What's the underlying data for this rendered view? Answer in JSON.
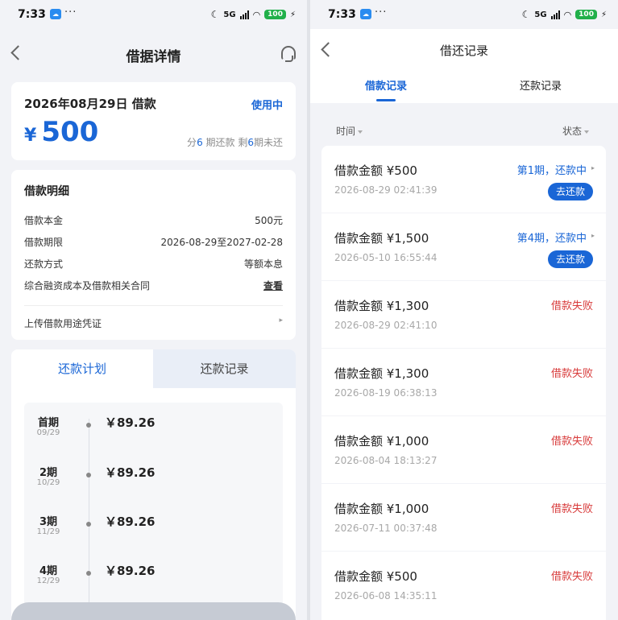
{
  "status_bar": {
    "time": "7:33",
    "network": "5G",
    "battery": "100"
  },
  "left": {
    "nav_title": "借据详情",
    "summary": {
      "date_label": "2026年08月29日 借款",
      "status": "使用中",
      "currency": "¥",
      "amount": "500",
      "terms_prefix": "分",
      "terms_total": "6",
      "terms_mid": " 期还款 剩",
      "terms_left": "6",
      "terms_suffix": "期未还"
    },
    "detail": {
      "title": "借款明细",
      "rows": [
        {
          "key": "借款本金",
          "value": "500元"
        },
        {
          "key": "借款期限",
          "value": "2026-08-29至2027-02-28"
        },
        {
          "key": "还款方式",
          "value": "等额本息"
        },
        {
          "key": "综合融资成本及借款相关合同",
          "value": "查看"
        }
      ],
      "upload": "上传借款用途凭证"
    },
    "tabs": {
      "active": "还款计划",
      "inactive": "还款记录"
    },
    "plan": [
      {
        "term": "首期",
        "date": "09/29",
        "amount": "￥89.26"
      },
      {
        "term": "2期",
        "date": "10/29",
        "amount": "￥89.26"
      },
      {
        "term": "3期",
        "date": "11/29",
        "amount": "￥89.26"
      },
      {
        "term": "4期",
        "date": "12/29",
        "amount": "￥89.26"
      }
    ]
  },
  "right": {
    "nav_title": "借还记录",
    "tabs": {
      "active": "借款记录",
      "inactive": "还款记录"
    },
    "filter": {
      "time": "时间",
      "status": "状态"
    },
    "records": [
      {
        "amount": "借款金额 ¥500",
        "time": "2026-08-29 02:41:39",
        "status": "第1期，还款中",
        "action": "去还款"
      },
      {
        "amount": "借款金额 ¥1,500",
        "time": "2026-05-10 16:55:44",
        "status": "第4期，还款中",
        "action": "去还款"
      },
      {
        "amount": "借款金额 ¥1,300",
        "time": "2026-08-29 02:41:10",
        "status": "借款失败"
      },
      {
        "amount": "借款金额 ¥1,300",
        "time": "2026-08-19 06:38:13",
        "status": "借款失败"
      },
      {
        "amount": "借款金额 ¥1,000",
        "time": "2026-08-04 18:13:27",
        "status": "借款失败"
      },
      {
        "amount": "借款金额 ¥1,000",
        "time": "2026-07-11 00:37:48",
        "status": "借款失败"
      },
      {
        "amount": "借款金额 ¥500",
        "time": "2026-06-08 14:35:11",
        "status": "借款失败"
      }
    ]
  },
  "colors": {
    "accent": "#1a66d6",
    "fail": "#d83b3b",
    "battery": "#21b04a"
  }
}
